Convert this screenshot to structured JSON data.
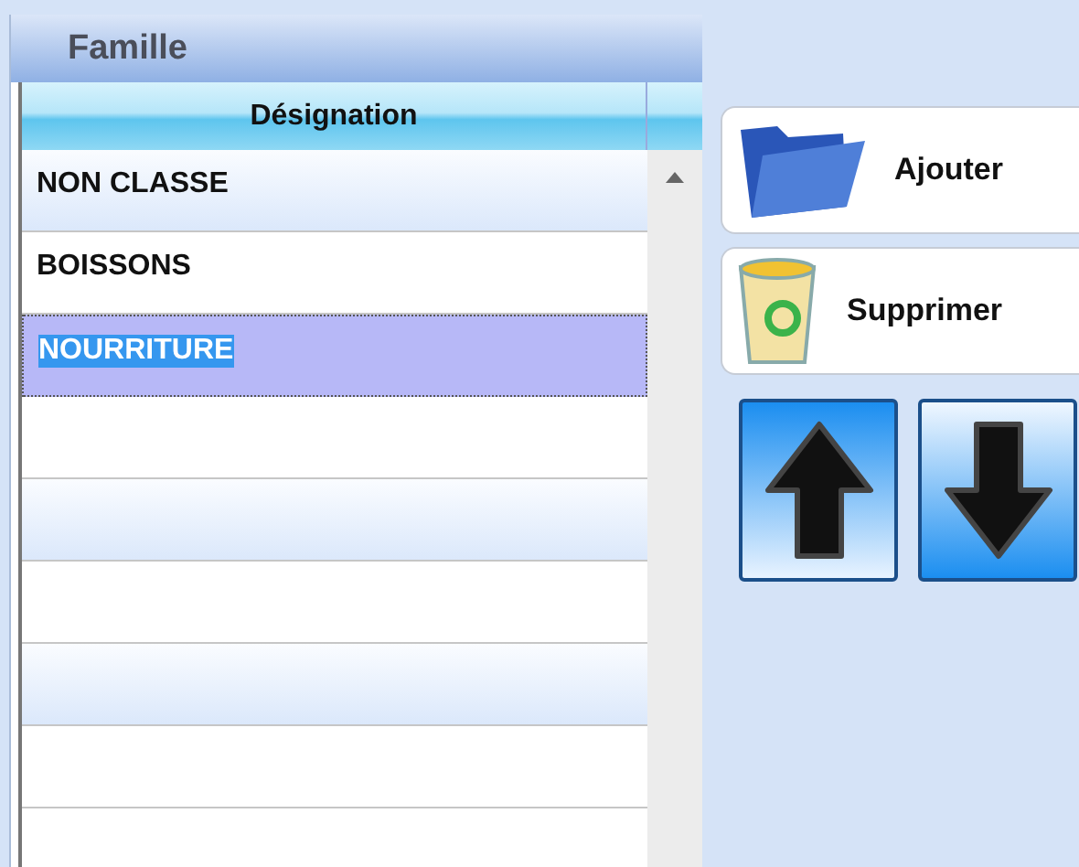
{
  "panel": {
    "title": "Famille"
  },
  "table": {
    "columns": [
      "Désignation"
    ],
    "rows": [
      {
        "designation": "NON CLASSE",
        "selected": false
      },
      {
        "designation": "BOISSONS",
        "selected": false
      },
      {
        "designation": "NOURRITURE",
        "selected": true
      }
    ]
  },
  "buttons": [
    {
      "label": "Ajouter",
      "kind": "add"
    },
    {
      "label": "Supprimer",
      "kind": "delete"
    }
  ],
  "move_buttons": [
    {
      "kind": "up"
    },
    {
      "kind": "down"
    }
  ]
}
